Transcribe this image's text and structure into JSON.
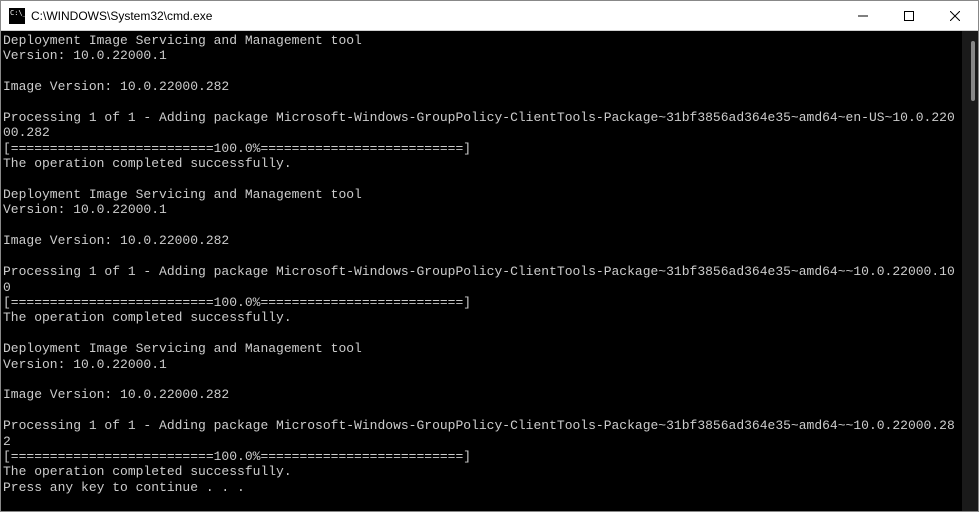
{
  "window": {
    "title": "C:\\WINDOWS\\System32\\cmd.exe"
  },
  "console": {
    "blocks": [
      {
        "header": "Deployment Image Servicing and Management tool",
        "version": "Version: 10.0.22000.1",
        "image_version": "Image Version: 10.0.22000.282",
        "processing": "Processing 1 of 1 - Adding package Microsoft-Windows-GroupPolicy-ClientTools-Package~31bf3856ad364e35~amd64~en-US~10.0.22000.282",
        "progress": "[==========================100.0%==========================]",
        "result": "The operation completed successfully."
      },
      {
        "header": "Deployment Image Servicing and Management tool",
        "version": "Version: 10.0.22000.1",
        "image_version": "Image Version: 10.0.22000.282",
        "processing": "Processing 1 of 1 - Adding package Microsoft-Windows-GroupPolicy-ClientTools-Package~31bf3856ad364e35~amd64~~10.0.22000.100",
        "progress": "[==========================100.0%==========================]",
        "result": "The operation completed successfully."
      },
      {
        "header": "Deployment Image Servicing and Management tool",
        "version": "Version: 10.0.22000.1",
        "image_version": "Image Version: 10.0.22000.282",
        "processing": "Processing 1 of 1 - Adding package Microsoft-Windows-GroupPolicy-ClientTools-Package~31bf3856ad364e35~amd64~~10.0.22000.282",
        "progress": "[==========================100.0%==========================]",
        "result": "The operation completed successfully."
      }
    ],
    "prompt": "Press any key to continue . . ."
  }
}
